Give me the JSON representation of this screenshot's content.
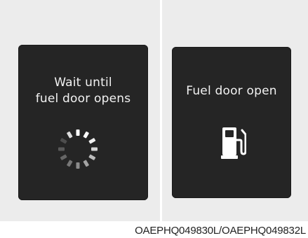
{
  "left_panel": {
    "message_lines": [
      "Wait until",
      "fuel door opens"
    ],
    "icon": "loading-spinner-icon"
  },
  "right_panel": {
    "message": "Fuel door open",
    "icon": "fuel-pump-icon"
  },
  "caption": "OAEPHQ049830L/OAEPHQ049832L",
  "colors": {
    "background": "#ececec",
    "screen": "#252525",
    "text": "#f2f2f2"
  }
}
